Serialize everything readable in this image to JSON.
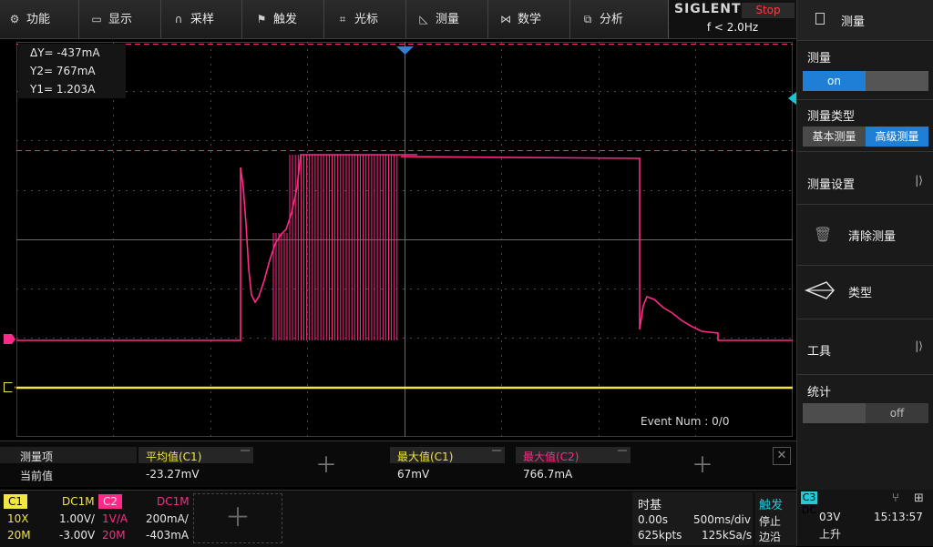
{
  "menu": {
    "items": [
      {
        "label": "功能",
        "icon": "gear-icon",
        "glyph": "⚙"
      },
      {
        "label": "显示",
        "icon": "monitor-icon",
        "glyph": "▭"
      },
      {
        "label": "采样",
        "icon": "acquire-icon",
        "glyph": "∩"
      },
      {
        "label": "触发",
        "icon": "flag-icon",
        "glyph": "⚑"
      },
      {
        "label": "光标",
        "icon": "cursor-icon",
        "glyph": "⌗"
      },
      {
        "label": "测量",
        "icon": "ruler-icon",
        "glyph": "◺"
      },
      {
        "label": "数学",
        "icon": "math-icon",
        "glyph": "⋈"
      },
      {
        "label": "分析",
        "icon": "analysis-icon",
        "glyph": "⧉"
      }
    ]
  },
  "status": {
    "brand": "SIGLENT",
    "run_state": "Stop",
    "frequency": "f < 2.0Hz"
  },
  "cursor_info": {
    "delta_y": "ΔY= -437mA",
    "y2": "Y2= 767mA",
    "y1": "Y1= 1.203A"
  },
  "event_num": "Event Num : 0/0",
  "right_panel": {
    "header": "测量",
    "measure": {
      "label": "测量",
      "on": "on"
    },
    "measure_type": {
      "label": "测量类型",
      "basic": "基本测量",
      "advanced": "高级测量"
    },
    "settings": "测量设置",
    "clear": "清除测量",
    "type": "类型",
    "tools": "工具",
    "stats": {
      "label": "统计",
      "off": "off"
    }
  },
  "measure_table": {
    "col_item": "测量项",
    "row_label": "当前值",
    "avg_c1_label": "平均值(C1)",
    "avg_c1_value": "-23.27mV",
    "max_c1_label": "最大值(C1)",
    "max_c1_value": "67mV",
    "max_c2_label": "最大值(C2)",
    "max_c2_value": "766.7mA"
  },
  "channels": {
    "c1": {
      "name": "C1",
      "coupling": "DC1M",
      "probe": "10X",
      "scale": "1.00V/",
      "bw": "20M",
      "offset": "-3.00V"
    },
    "c2": {
      "name": "C2",
      "coupling": "DC1M",
      "probe": "1V/A",
      "scale": "200mA/",
      "bw": "20M",
      "offset": "-403mA"
    }
  },
  "timebase": {
    "label": "时基",
    "delay": "0.00s",
    "scale": "500ms/div",
    "points": "625kpts",
    "rate": "125kSa/s"
  },
  "trigger": {
    "label": "触发",
    "source": "C3 DC",
    "mode": "停止",
    "type": "边沿",
    "level": "03V",
    "edge": "上升"
  },
  "clock": "15:13:57",
  "colors": {
    "c1": "#f2e640",
    "c2": "#ff2a87",
    "accent": "#1f7fd6",
    "frame": "#2a2a2a"
  }
}
